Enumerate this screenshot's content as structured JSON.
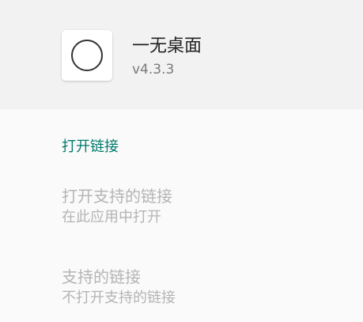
{
  "app": {
    "name": "一无桌面",
    "version": "v4.3.3"
  },
  "section": {
    "title": "打开链接"
  },
  "preferences": [
    {
      "title": "打开支持的链接",
      "summary": "在此应用中打开"
    },
    {
      "title": "支持的链接",
      "summary": "不打开支持的链接"
    }
  ],
  "colors": {
    "accent": "#00796b",
    "header_bg": "#f2f2f2",
    "page_bg": "#fafafa",
    "disabled_text": "#b4b4b4"
  }
}
